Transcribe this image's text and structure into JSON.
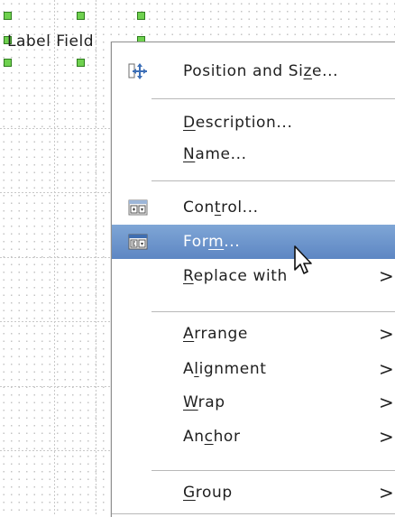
{
  "canvas": {
    "field_label": "Label Field"
  },
  "context_menu": {
    "items": [
      {
        "pre": "Position and Si",
        "ul": "z",
        "post": "e...",
        "icon": "position-size-icon",
        "submenu": false
      },
      {
        "pre": "",
        "ul": "D",
        "post": "escription...",
        "icon": "",
        "submenu": false
      },
      {
        "pre": "",
        "ul": "N",
        "post": "ame...",
        "icon": "",
        "submenu": false
      },
      {
        "pre": "Con",
        "ul": "t",
        "post": "rol...",
        "icon": "control-icon",
        "submenu": false
      },
      {
        "pre": "For",
        "ul": "m",
        "post": "...",
        "icon": "form-icon",
        "submenu": false,
        "highlighted": true
      },
      {
        "pre": "",
        "ul": "R",
        "post": "eplace with",
        "icon": "",
        "submenu": true
      },
      {
        "pre": "",
        "ul": "A",
        "post": "rrange",
        "icon": "",
        "submenu": true
      },
      {
        "pre": "A",
        "ul": "l",
        "post": "ignment",
        "icon": "",
        "submenu": true
      },
      {
        "pre": "",
        "ul": "W",
        "post": "rap",
        "icon": "",
        "submenu": true
      },
      {
        "pre": "An",
        "ul": "c",
        "post": "hor",
        "icon": "",
        "submenu": true
      },
      {
        "pre": "",
        "ul": "G",
        "post": "roup",
        "icon": "",
        "submenu": true
      }
    ],
    "submenu_arrow": ">"
  },
  "colors": {
    "highlight": "#6a91c9",
    "handle": "#6fd14f"
  }
}
